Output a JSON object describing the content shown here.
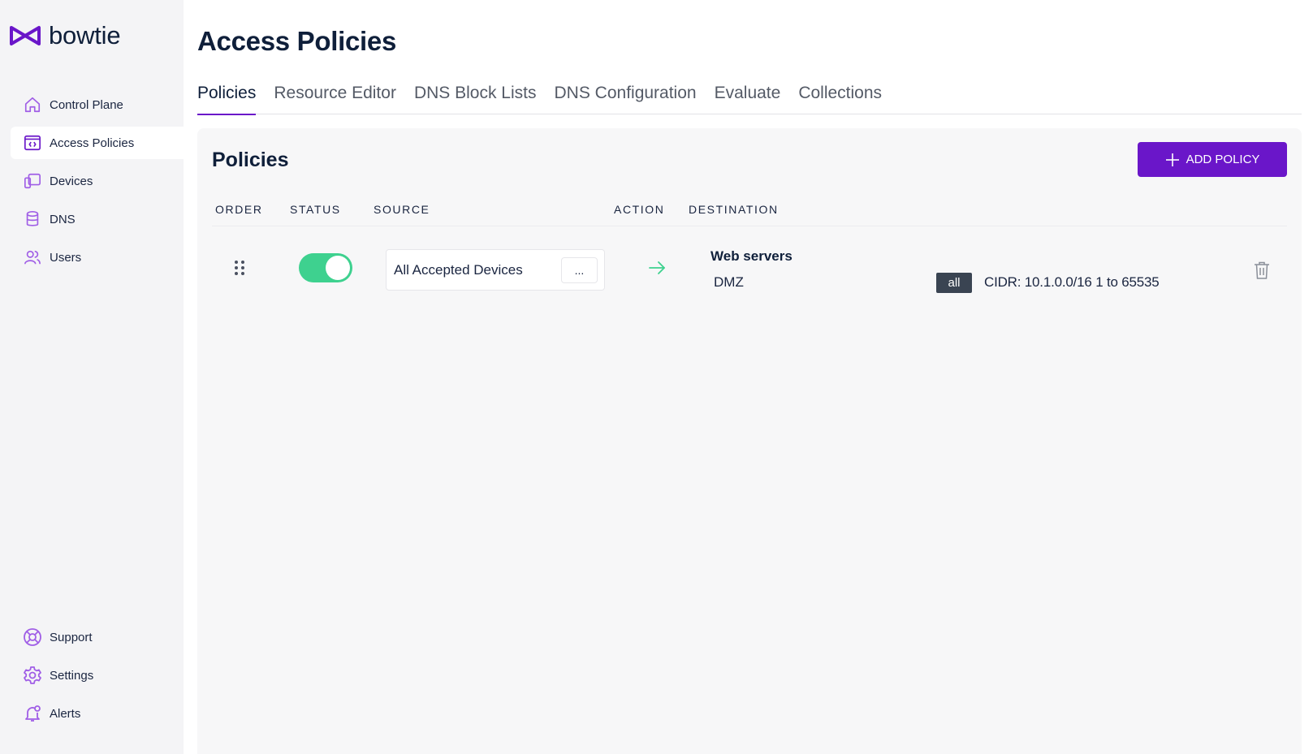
{
  "brand": {
    "name": "bowtie",
    "accent": "#6a16c9",
    "icon": "bowtie-logo-icon"
  },
  "sidebar": {
    "items": [
      {
        "label": "Control Plane",
        "icon": "home-icon",
        "active": false
      },
      {
        "label": "Access Policies",
        "icon": "code-window-icon",
        "active": true
      },
      {
        "label": "Devices",
        "icon": "devices-icon",
        "active": false
      },
      {
        "label": "DNS",
        "icon": "database-icon",
        "active": false
      },
      {
        "label": "Users",
        "icon": "users-icon",
        "active": false
      }
    ],
    "bottom_items": [
      {
        "label": "Support",
        "icon": "lifebuoy-icon"
      },
      {
        "label": "Settings",
        "icon": "gear-icon"
      },
      {
        "label": "Alerts",
        "icon": "bell-icon"
      }
    ]
  },
  "page": {
    "title": "Access Policies"
  },
  "tabs": [
    {
      "label": "Policies",
      "active": true
    },
    {
      "label": "Resource Editor",
      "active": false
    },
    {
      "label": "DNS Block Lists",
      "active": false
    },
    {
      "label": "DNS Configuration",
      "active": false
    },
    {
      "label": "Evaluate",
      "active": false
    },
    {
      "label": "Collections",
      "active": false
    }
  ],
  "policies": {
    "title": "Policies",
    "add_button": "ADD POLICY",
    "columns": {
      "order": "ORDER",
      "status": "STATUS",
      "source": "SOURCE",
      "action": "ACTION",
      "destination": "DESTINATION"
    },
    "rows": [
      {
        "enabled": true,
        "source": "All Accepted Devices",
        "source_more": "...",
        "action_icon": "arrow-right-icon",
        "destination_name": "Web servers",
        "destination_collection": "DMZ",
        "protocol": "all",
        "cidr": "CIDR: 10.1.0.0/16 1 to 65535"
      }
    ]
  },
  "colors": {
    "toggle_on": "#3ed18f",
    "sidebar_bg": "#f4f4f6",
    "panel_bg": "#f7f7f8",
    "badge_bg": "#3a4452"
  }
}
